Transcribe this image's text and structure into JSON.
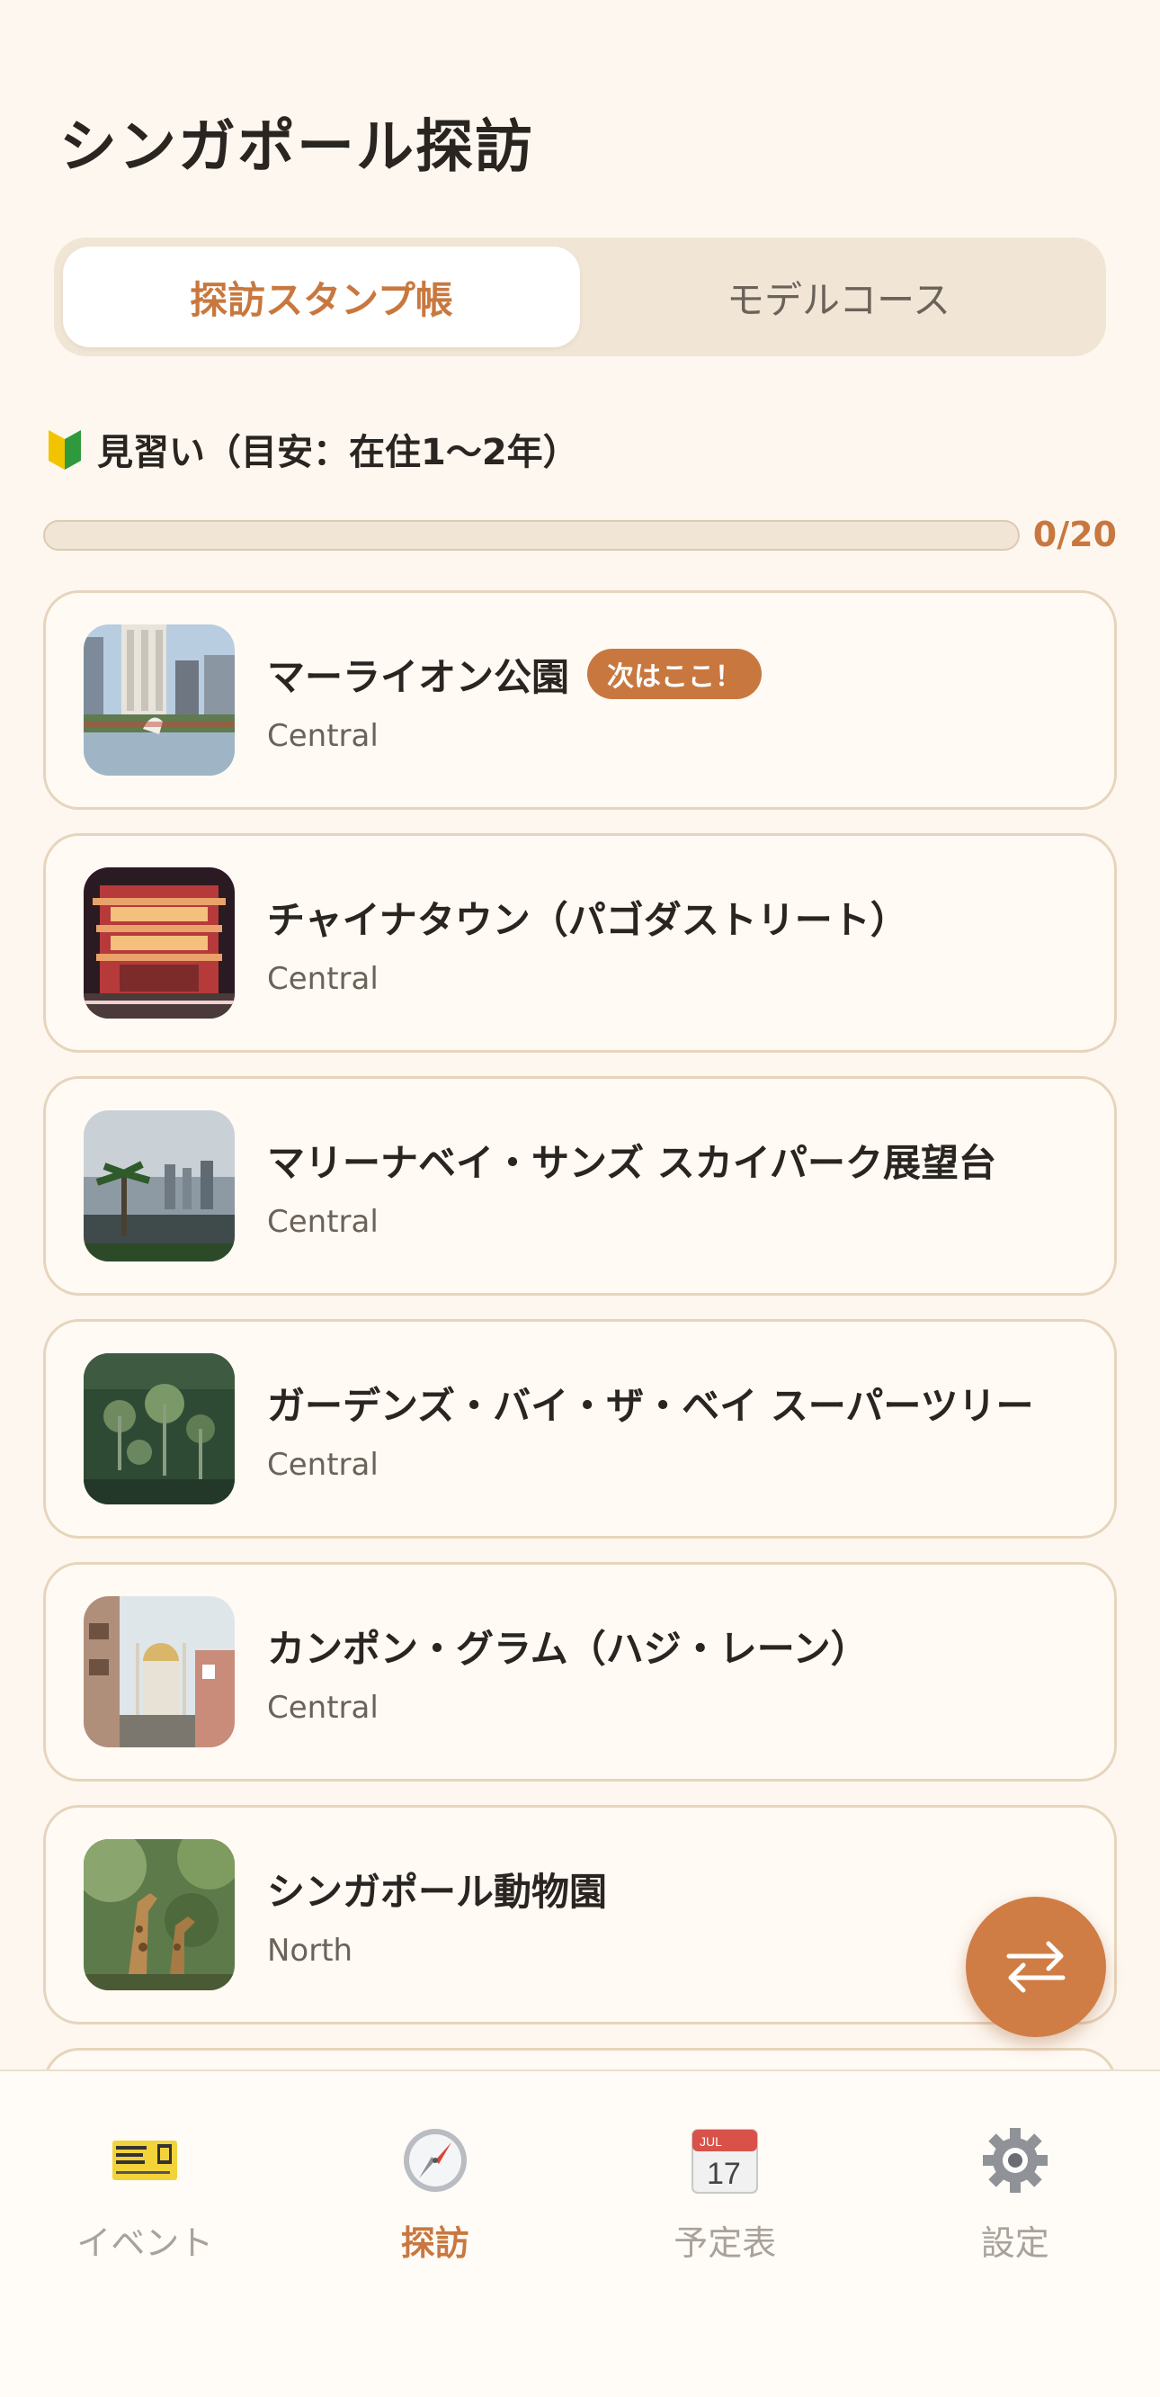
{
  "header": {
    "title": "シンガポール探訪"
  },
  "segments": [
    {
      "label": "探訪スタンプ帳",
      "active": true
    },
    {
      "label": "モデルコース",
      "active": false
    }
  ],
  "level": {
    "icon": "beginner-mark-icon",
    "label": "見習い（目安：在住1〜2年）"
  },
  "progress": {
    "current": 0,
    "total": 20,
    "text": "0/20",
    "fraction": 0
  },
  "spots": [
    {
      "name": "マーライオン公園",
      "area": "Central",
      "badge": "次はここ！"
    },
    {
      "name": "チャイナタウン（パゴダストリート）",
      "area": "Central"
    },
    {
      "name": "マリーナベイ・サンズ スカイパーク展望台",
      "area": "Central"
    },
    {
      "name": "ガーデンズ・バイ・ザ・ベイ スーパーツリー",
      "area": "Central"
    },
    {
      "name": "カンポン・グラム（ハジ・レーン）",
      "area": "Central"
    },
    {
      "name": "シンガポール動物園",
      "area": "North"
    }
  ],
  "fab": {
    "icon": "swap-arrows-icon"
  },
  "tabbar": [
    {
      "label": "イベント",
      "icon": "ticket-icon",
      "active": false
    },
    {
      "label": "探訪",
      "icon": "compass-icon",
      "active": true
    },
    {
      "label": "予定表",
      "icon": "calendar-icon",
      "active": false
    },
    {
      "label": "設定",
      "icon": "gear-icon",
      "active": false
    }
  ],
  "calendar_icon": {
    "month": "JUL",
    "day": "17"
  },
  "colors": {
    "accent": "#c8783f",
    "background": "#fdf7f0",
    "segment_bg": "#f1e6d5"
  }
}
